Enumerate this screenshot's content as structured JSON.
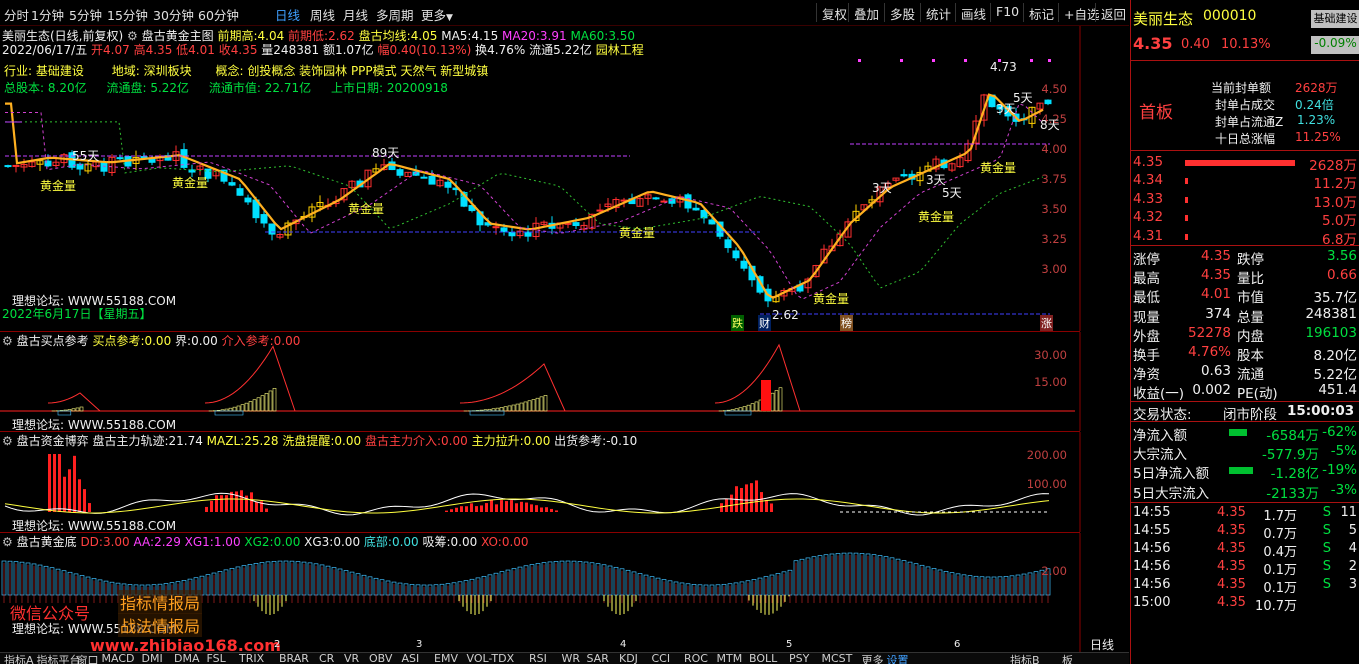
{
  "topbar": {
    "periods": [
      "分时",
      "1分钟",
      "5分钟",
      "15分钟",
      "30分钟",
      "60分钟",
      "日线",
      "周线",
      "月线",
      "多周期",
      "更多"
    ],
    "active_period": "日线",
    "more_arrow": "▼",
    "buttons": [
      "复权",
      "叠加",
      "多股",
      "统计",
      "画线",
      "F10",
      "标记",
      "+自选",
      "返回"
    ]
  },
  "main": {
    "stock_title": "美丽生态(日线,前复权)",
    "indicator_name": "盘古黄金主图",
    "prev_high_label": "前期高:",
    "prev_high": "4.04",
    "prev_low_label": "前期低:",
    "prev_low": "2.62",
    "avg_label": "盘古均线:",
    "avg": "4.05",
    "ma5_label": "MA5:",
    "ma5": "4.15",
    "ma20_label": "MA20:",
    "ma20": "3.91",
    "ma60_label": "MA60:",
    "ma60": "3.50",
    "date_line": "2022/06/17/五",
    "open": "开4.07",
    "high": "高4.35",
    "low": "低4.01",
    "close": "收4.35",
    "volume": "量248381",
    "amount": "额1.07亿",
    "change": "幅0.40(10.13%)",
    "turnover": "换4.76%",
    "float_cap": "流通5.22亿",
    "concept_tag": "园林工程",
    "industry_label": "行业:",
    "industry": "基础建设",
    "region_label": "地域:",
    "region": "深圳板块",
    "concept_label": "概念:",
    "concepts": "创投概念 装饰园林 PPP模式 天然气 新型城镇",
    "total_shares_label": "总股本:",
    "total_shares": "8.20亿",
    "float_shares_label": "流通盘:",
    "float_shares": "5.22亿",
    "float_mv_label": "流通市值:",
    "float_mv": "22.71亿",
    "listing_label": "上市日期:",
    "listing_date": "20200918",
    "forum": "理想论坛: WWW.55188.COM",
    "cursor_date": "2022年6月17日【星期五】",
    "price_axis": [
      "4.50",
      "4.25",
      "4.00",
      "3.75",
      "3.50",
      "3.25",
      "3.00"
    ],
    "annotations": {
      "gold1": "黄金量",
      "gold2": "黄金量",
      "gold3": "黄金量",
      "gold4": "黄金量",
      "gold5": "黄金量",
      "gold6": "黄金量",
      "gold7": "黄金量",
      "d55": "55天",
      "d89": "89天",
      "d3a": "3天",
      "d3b": "3天",
      "d3c": "3天",
      "d5a": "5天",
      "d5b": "5天",
      "d8": "8天",
      "peak": "4.73",
      "trough": "2.62",
      "tag_die": "跌",
      "tag_cai": "财",
      "tag_bang": "榜",
      "tag_zhang": "涨"
    }
  },
  "pane1": {
    "title": "盘古买点参考",
    "buy_ref_label": "买点参考:",
    "buy_ref": "0.00",
    "jie_label": "界:",
    "jie": "0.00",
    "intervene_label": "介入参考:",
    "intervene": "0.00",
    "axis": [
      "30.00",
      "15.00"
    ],
    "forum": "理想论坛: WWW.55188.COM"
  },
  "pane2": {
    "title": "盘古资金博弈",
    "track_label": "盘古主力轨迹:",
    "track": "21.74",
    "mazl_label": "MAZL:",
    "mazl": "25.28",
    "wash_label": "洗盘提醒:",
    "wash": "0.00",
    "enter_label": "盘古主力介入:",
    "enter": "0.00",
    "pull_label": "主力拉升:",
    "pull": "0.00",
    "ship_label": "出货参考:",
    "ship": "-0.10",
    "axis": [
      "200.00",
      "100.00"
    ],
    "forum": "理想论坛: WWW.55188.COM"
  },
  "pane3": {
    "title": "盘古黄金底",
    "dd_label": "DD:",
    "dd": "3.00",
    "aa_label": "AA:",
    "aa": "2.29",
    "xg1_label": "XG1:",
    "xg1": "1.00",
    "xg2_label": "XG2:",
    "xg2": "0.00",
    "xg3_label": "XG3:",
    "xg3": "0.00",
    "bottom_label": "底部:",
    "bottom": "0.00",
    "absorb_label": "吸筹:",
    "absorb": "0.00",
    "xo_label": "XO:",
    "xo": "0.00",
    "axis": [
      "2.00"
    ],
    "forum": "理想论坛: WWW.55188.COM",
    "watermark1": "微信公众号",
    "watermark2": "指标情报局",
    "watermark3": "战法情报局",
    "watermark_url": "www.zhibiao168.com",
    "month_marks": [
      "2",
      "3",
      "4",
      "5",
      "6"
    ]
  },
  "bottombar": {
    "items": [
      "指标A",
      "指标平台",
      "窗口",
      "MACD",
      "DMI",
      "DMA",
      "FSL",
      "TRIX",
      "BRAR",
      "CR",
      "VR",
      "OBV",
      "ASI",
      "EMV",
      "VOL-TDX",
      "RSI",
      "WR",
      "SAR",
      "KDJ",
      "CCI",
      "ROC",
      "MTM",
      "BOLL",
      "PSY",
      "MCST",
      "更多",
      "设置"
    ],
    "right_items": [
      "指标B",
      "板"
    ],
    "period": "日线"
  },
  "right": {
    "name": "美丽生态",
    "code": "000010",
    "board_tag": "基础建设",
    "board_pct": "-0.09%",
    "price": "4.35",
    "change": "0.40",
    "pct": "10.13%",
    "first_board": "首板",
    "seal_amount_label": "当前封单额",
    "seal_amount": "2628万",
    "seal_trade_label": "封单占成交",
    "seal_trade": "0.24倍",
    "seal_float_label": "封单占流通Z",
    "seal_float": "1.23%",
    "ten_day_label": "十日总涨幅",
    "ten_day": "11.25%",
    "order_book": [
      {
        "price": "4.35",
        "vol": "2628万"
      },
      {
        "price": "4.34",
        "vol": "11.2万"
      },
      {
        "price": "4.33",
        "vol": "13.0万"
      },
      {
        "price": "4.32",
        "vol": "5.0万"
      },
      {
        "price": "4.31",
        "vol": "6.8万"
      }
    ],
    "stats": [
      {
        "l1": "涨停",
        "v1": "4.35",
        "l2": "跌停",
        "v2": "3.56"
      },
      {
        "l1": "最高",
        "v1": "4.35",
        "l2": "量比",
        "v2": "0.66"
      },
      {
        "l1": "最低",
        "v1": "4.01",
        "l2": "市值",
        "v2": "35.7亿"
      },
      {
        "l1": "现量",
        "v1": "374",
        "l2": "总量",
        "v2": "248381"
      },
      {
        "l1": "外盘",
        "v1": "52278",
        "l2": "内盘",
        "v2": "196103"
      },
      {
        "l1": "换手",
        "v1": "4.76%",
        "l2": "股本",
        "v2": "8.20亿"
      },
      {
        "l1": "净资",
        "v1": "0.63",
        "l2": "流通",
        "v2": "5.22亿"
      },
      {
        "l1": "收益(一)",
        "v1": "0.002",
        "l2": "PE(动)",
        "v2": "451.4"
      }
    ],
    "trade_status_label": "交易状态:",
    "trade_status": "闭市阶段",
    "trade_time": "15:00:03",
    "flows": [
      {
        "label": "净流入额",
        "value": "-6584万",
        "pct": "-62%"
      },
      {
        "label": "大宗流入",
        "value": "-577.9万",
        "pct": "-5%"
      },
      {
        "label": "5日净流入额",
        "value": "-1.28亿",
        "pct": "-19%"
      },
      {
        "label": "5日大宗流入",
        "value": "-2133万",
        "pct": "-3%"
      }
    ],
    "ticks": [
      {
        "time": "14:55",
        "price": "4.35",
        "vol": "1.7万",
        "side": "S",
        "n": "11"
      },
      {
        "time": "14:55",
        "price": "4.35",
        "vol": "0.7万",
        "side": "S",
        "n": "5"
      },
      {
        "time": "14:56",
        "price": "4.35",
        "vol": "0.4万",
        "side": "S",
        "n": "4"
      },
      {
        "time": "14:56",
        "price": "4.35",
        "vol": "0.1万",
        "side": "S",
        "n": "2"
      },
      {
        "time": "14:56",
        "price": "4.35",
        "vol": "0.1万",
        "side": "S",
        "n": "3"
      },
      {
        "time": "15:00",
        "price": "4.35",
        "vol": "10.7万",
        "side": "",
        "n": ""
      }
    ]
  }
}
